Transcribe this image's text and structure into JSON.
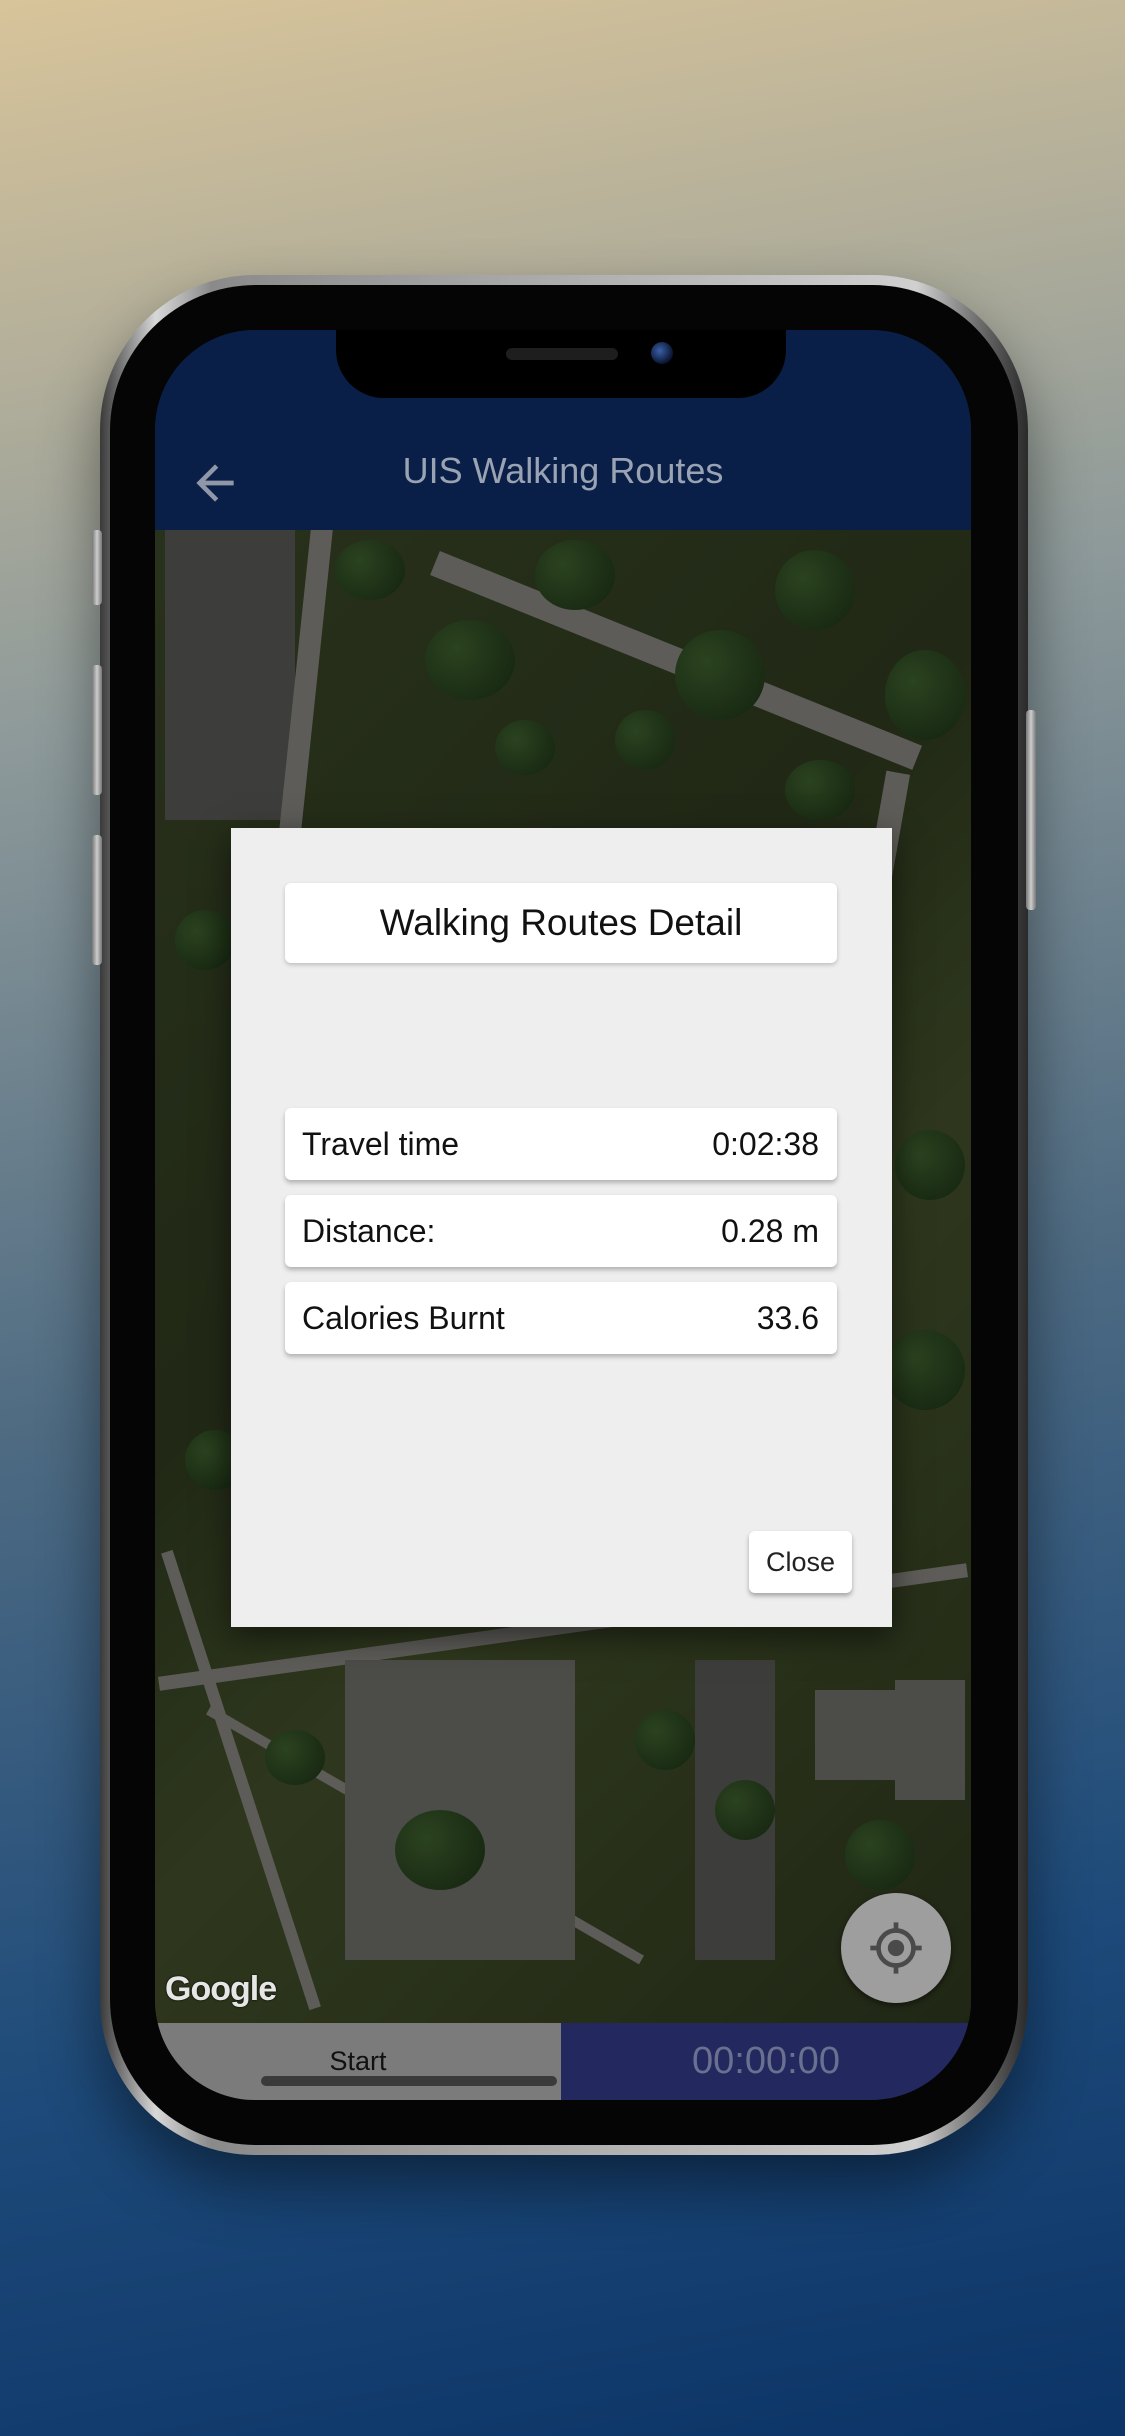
{
  "app_bar": {
    "title": "UIS Walking Routes",
    "back_icon": "arrow-left-icon"
  },
  "map": {
    "provider_label": "Google",
    "locate_icon": "my-location-icon"
  },
  "bottom_bar": {
    "start_label": "Start",
    "timer": "00:00:00"
  },
  "dialog": {
    "title": "Walking Routes Detail",
    "rows": [
      {
        "label": "Travel time",
        "value": "0:02:38"
      },
      {
        "label": "Distance:",
        "value": "0.28 m"
      },
      {
        "label": "Calories Burnt",
        "value": "33.6"
      }
    ],
    "close_label": "Close"
  },
  "colors": {
    "app_bar": "#0a1f47",
    "timer_bg": "#23285f",
    "start_bg": "#7b7b7b",
    "dialog_bg": "#eeeeee"
  }
}
